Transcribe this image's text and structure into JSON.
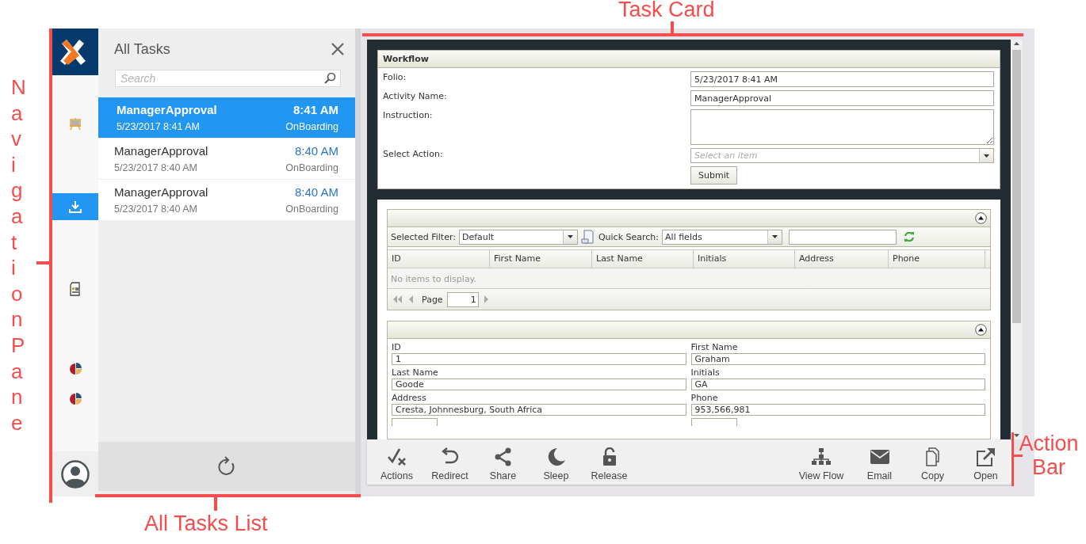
{
  "annotations": [
    {
      "text": "Navigation Pane"
    },
    {
      "text": "Task Card"
    },
    {
      "text": "All Tasks List"
    },
    {
      "text": "Action Bar"
    }
  ],
  "navigation": {
    "items": [
      {
        "kind": "presentation",
        "selected": false
      },
      {
        "kind": "inbox",
        "selected": true
      },
      {
        "kind": "form",
        "selected": false
      },
      {
        "kind": "chart",
        "selected": false
      },
      {
        "kind": "chart",
        "selected": false
      }
    ]
  },
  "task_list": {
    "title": "All Tasks",
    "search": {
      "placeholder": "Search"
    },
    "tasks": [
      {
        "name": "ManagerApproval",
        "time": "8:41 AM",
        "date": "5/23/2017 8:41 AM",
        "process": "OnBoarding",
        "selected": true
      },
      {
        "name": "ManagerApproval",
        "time": "8:40 AM",
        "date": "5/23/2017 8:40 AM",
        "process": "OnBoarding",
        "selected": false
      },
      {
        "name": "ManagerApproval",
        "time": "8:40 AM",
        "date": "5/23/2017 8:40 AM",
        "process": "OnBoarding",
        "selected": false
      }
    ]
  },
  "workflow": {
    "title": "Workflow",
    "fields": [
      {
        "kind": "text",
        "label": "Folio:",
        "value": "5/23/2017 8:41 AM"
      },
      {
        "kind": "text",
        "label": "Activity Name:",
        "value": "ManagerApproval"
      },
      {
        "kind": "textarea",
        "label": "Instruction:"
      },
      {
        "kind": "select",
        "label": "Select Action:",
        "placeholder": "Select an item"
      }
    ],
    "submit": "Submit"
  },
  "grid": {
    "filter_label": "Selected Filter:",
    "filter_value": "Default",
    "quick_search_label": "Quick Search:",
    "quick_search_value": "All fields",
    "columns": [
      "ID",
      "First Name",
      "Last Name",
      "Initials",
      "Address",
      "Phone"
    ],
    "empty_message": "No items to display.",
    "page_label": "Page",
    "page": "1"
  },
  "detail_form": {
    "fields": [
      {
        "label": "ID",
        "value": "1"
      },
      {
        "label": "First Name",
        "value": "Graham"
      },
      {
        "label": "Last Name",
        "value": "Goode"
      },
      {
        "label": "Initials",
        "value": "GA"
      },
      {
        "label": "Address",
        "value": "Cresta, Johnnesburg, South Africa"
      },
      {
        "label": "Phone",
        "value": "953,566,981"
      }
    ]
  },
  "action_bar": {
    "left": [
      {
        "label": "Actions"
      },
      {
        "label": "Redirect"
      },
      {
        "label": "Share"
      },
      {
        "label": "Sleep"
      },
      {
        "label": "Release"
      }
    ],
    "right": [
      {
        "label": "View Flow"
      },
      {
        "label": "Email"
      },
      {
        "label": "Copy"
      },
      {
        "label": "Open"
      }
    ]
  }
}
